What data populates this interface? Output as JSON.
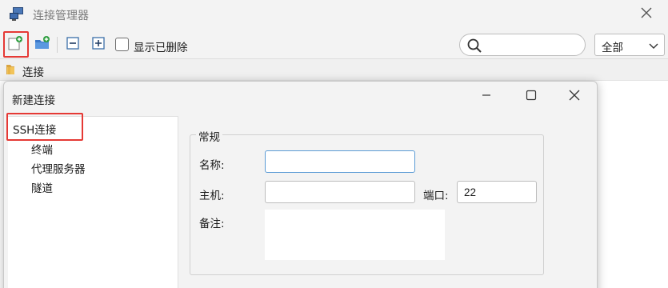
{
  "window": {
    "title": "连接管理器"
  },
  "toolbar": {
    "show_deleted_label": "显示已删除",
    "show_deleted_checked": false,
    "search": {
      "value": "",
      "placeholder": ""
    },
    "filter": {
      "selected": "全部"
    }
  },
  "breadcrumb": {
    "label": "连接"
  },
  "dialog": {
    "title": "新建连接",
    "tree": {
      "root": "SSH连接",
      "children": [
        "终端",
        "代理服务器",
        "隧道"
      ]
    },
    "group_label": "常规",
    "fields": {
      "name_label": "名称:",
      "name_value": "",
      "host_label": "主机:",
      "host_value": "",
      "port_label": "端口:",
      "port_value": "22",
      "notes_label": "备注:",
      "notes_value": ""
    }
  },
  "colors": {
    "highlight": "#e53935",
    "focus_border": "#5b9bd5",
    "window_bg": "#f3f3f3"
  }
}
